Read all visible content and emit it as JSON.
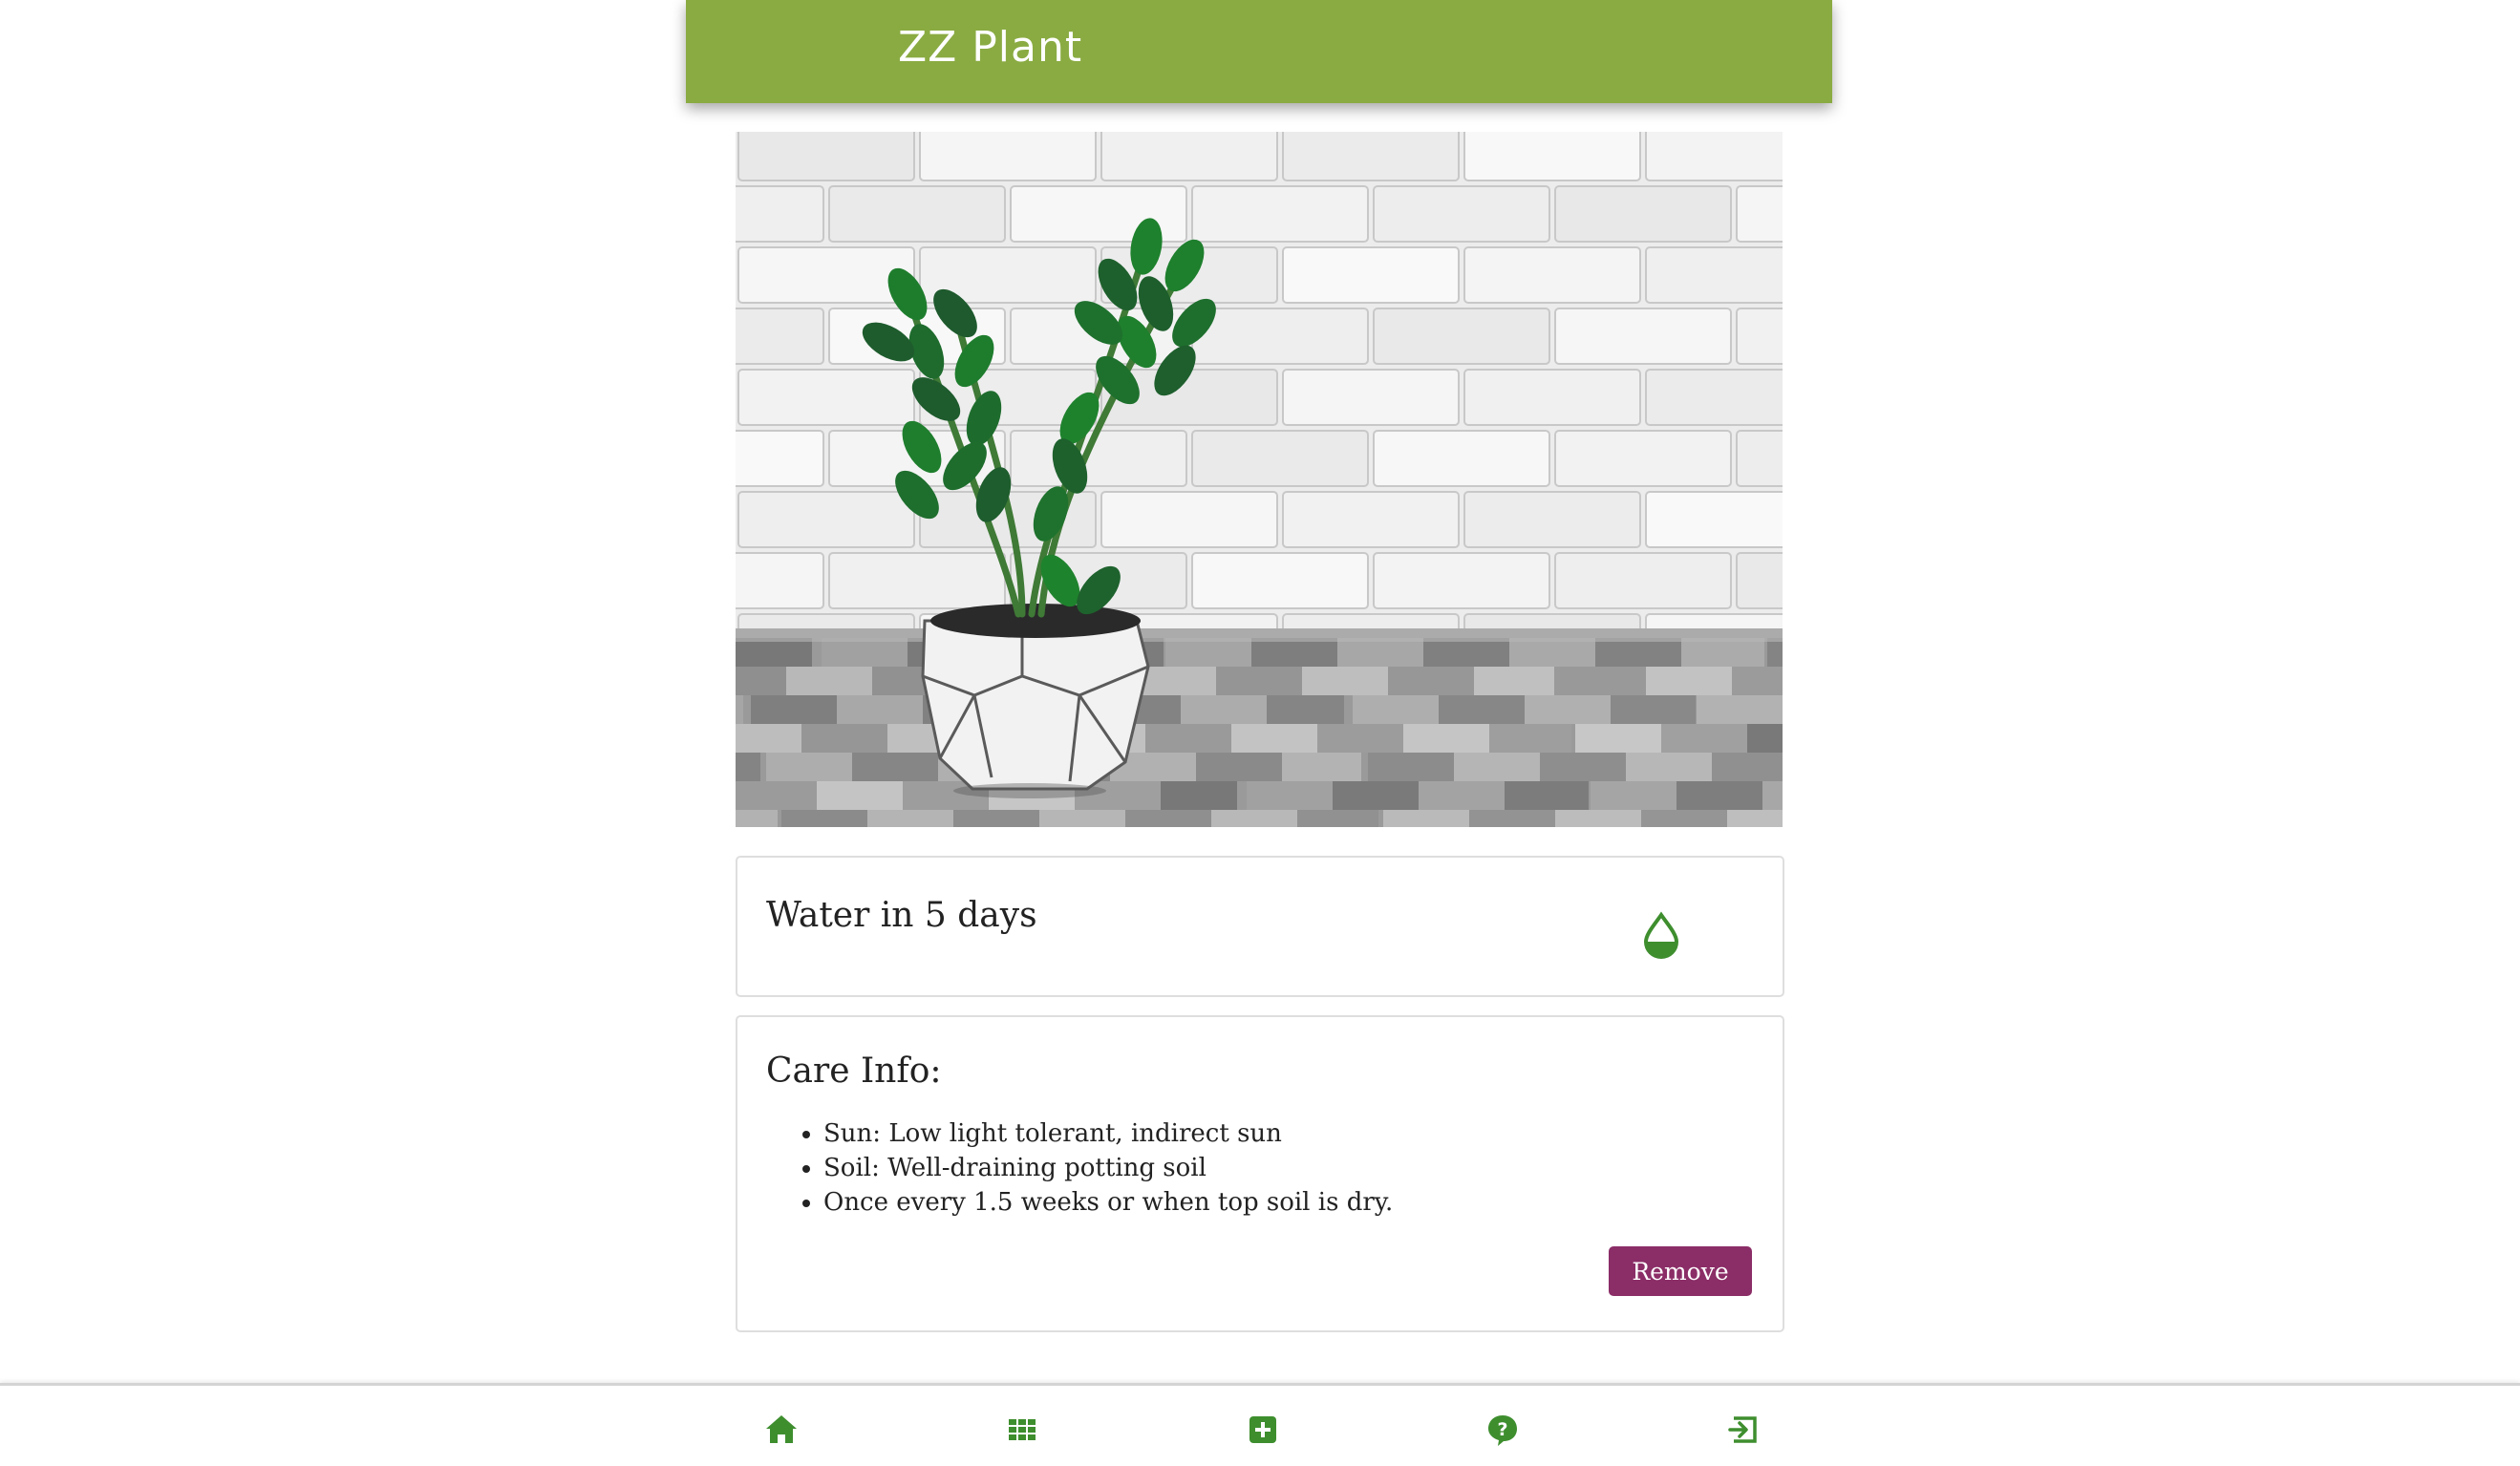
{
  "header": {
    "title": "ZZ Plant"
  },
  "plant_photo": {
    "alt": "ZZ plant in a white geometric pot against a white brick wall"
  },
  "water_card": {
    "text": "Water in 5 days",
    "icon": "water-drop-icon"
  },
  "care_card": {
    "title": "Care Info:",
    "items": [
      "Sun: Low light tolerant, indirect sun",
      "Soil: Well-draining potting soil",
      "Once every 1.5 weeks or when top soil is dry."
    ],
    "remove_label": "Remove"
  },
  "nav": {
    "items": [
      {
        "icon": "home-icon"
      },
      {
        "icon": "grid-icon"
      },
      {
        "icon": "add-square-icon"
      },
      {
        "icon": "help-icon"
      },
      {
        "icon": "sign-out-icon"
      }
    ]
  },
  "colors": {
    "header_bg": "#8aab42",
    "accent_green": "#3e8e2e",
    "remove_button": "#8b2d67"
  }
}
